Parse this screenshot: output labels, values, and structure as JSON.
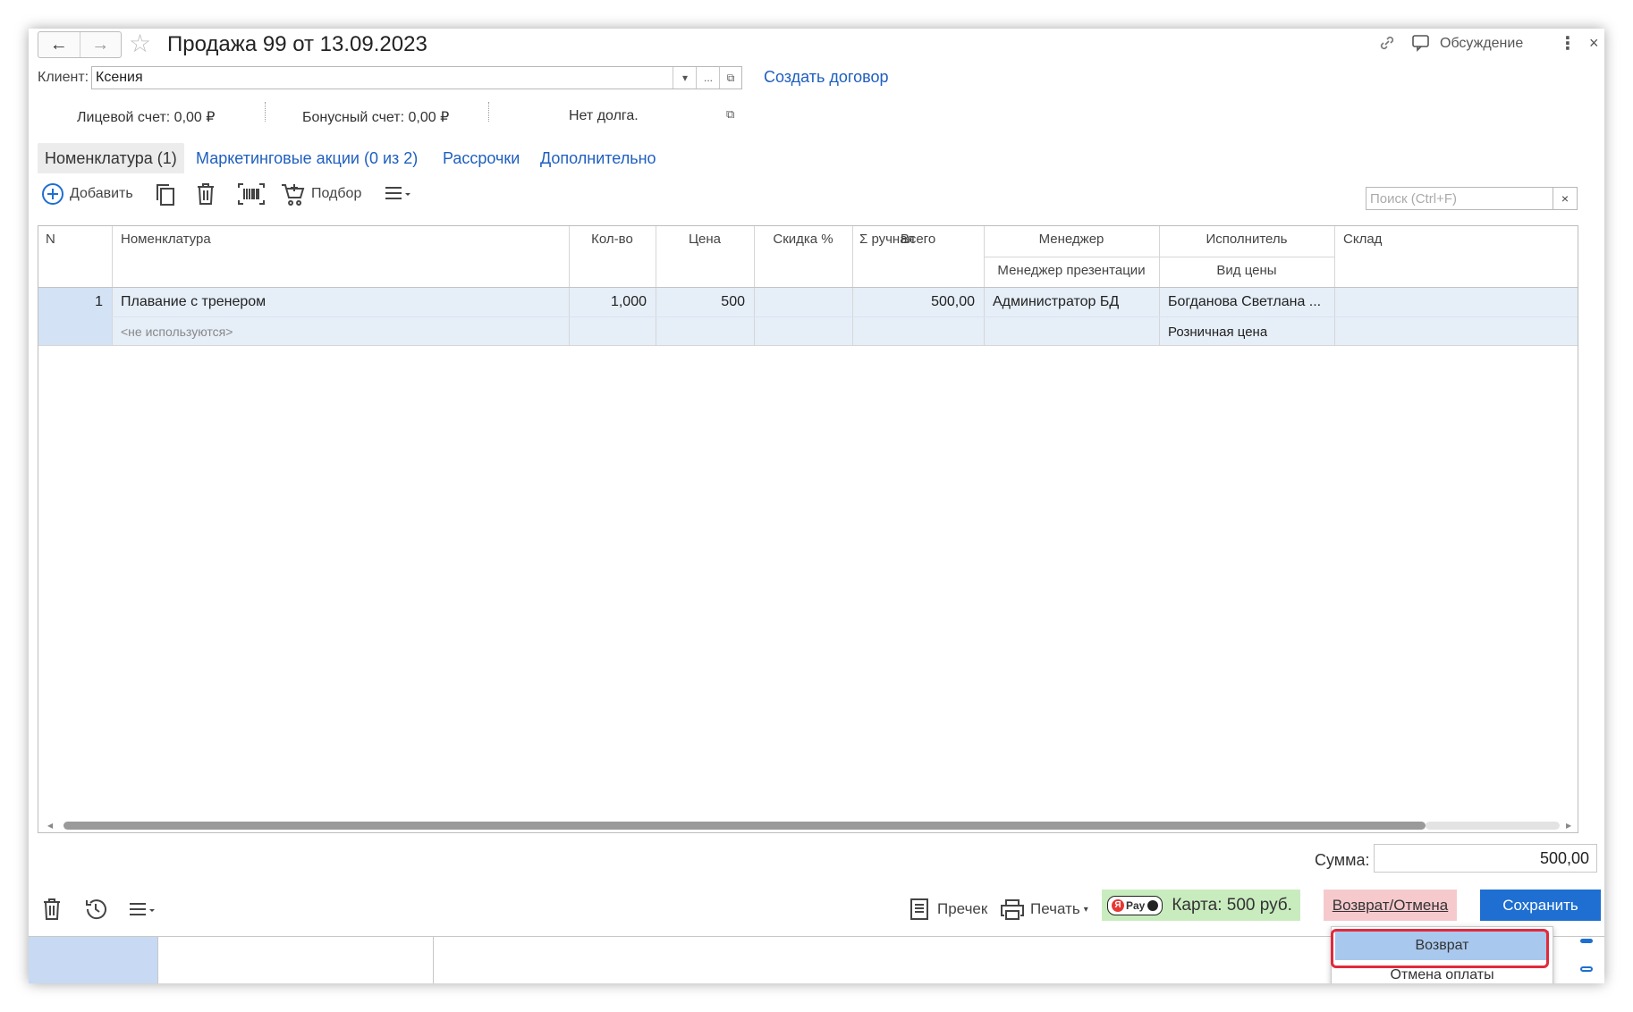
{
  "window": {
    "title": "Продажа 99 от 13.09.2023",
    "discussion_label": "Обсуждение",
    "close_glyph": "×"
  },
  "client": {
    "label": "Клиент:",
    "value": "Ксения",
    "create_contract_link": "Создать договор"
  },
  "accounts": {
    "personal": "Лицевой счет: 0,00 ₽",
    "bonus": "Бонусный счет: 0,00 ₽",
    "debt": "Нет долга."
  },
  "tabs": [
    {
      "label": "Номенклатура (1)",
      "active": true
    },
    {
      "label": "Маркетинговые акции (0 из 2)",
      "active": false
    },
    {
      "label": "Рассрочки",
      "active": false
    },
    {
      "label": "Дополнительно",
      "active": false
    }
  ],
  "toolbar": {
    "add_label": "Добавить",
    "select_label": "Подбор",
    "search_placeholder": "Поиск (Ctrl+F)",
    "search_clear": "×"
  },
  "table": {
    "headers": {
      "n": "N",
      "item": "Номенклатура",
      "qty": "Кол-во",
      "price": "Цена",
      "discount": "Скидка %",
      "manual": "Σ ручная",
      "total": "Всего",
      "manager": "Менеджер",
      "manager_presentation": "Менеджер презентации",
      "executor": "Исполнитель",
      "price_type": "Вид цены",
      "warehouse": "Склад"
    },
    "rows": [
      {
        "n": "1",
        "item": "Плавание с тренером",
        "item_sub": "<не используются>",
        "qty": "1,000",
        "price": "500",
        "discount": "",
        "manual": "",
        "total": "500,00",
        "manager": "Администратор БД",
        "manager_presentation": "",
        "executor": "Богданова Светлана ...",
        "price_type": "Розничная цена",
        "warehouse": ""
      }
    ]
  },
  "footer": {
    "sum_label": "Сумма:",
    "sum_value": "500,00",
    "precheck_label": "Пречек",
    "print_label": "Печать",
    "pay_badge": "Pay",
    "card_label": "Карта: 500 руб.",
    "return_cancel_label": "Возврат/Отмена",
    "save_label": "Сохранить"
  },
  "dropdown": {
    "items": [
      "Возврат",
      "Отмена оплаты"
    ]
  },
  "colors": {
    "link": "#1f5fbf",
    "selected_row": "#e6eef8",
    "card_bg": "#c9ecbf",
    "return_bg": "#f6c9cd",
    "save_bg": "#1e6fd1",
    "highlight": "#e2293c"
  }
}
